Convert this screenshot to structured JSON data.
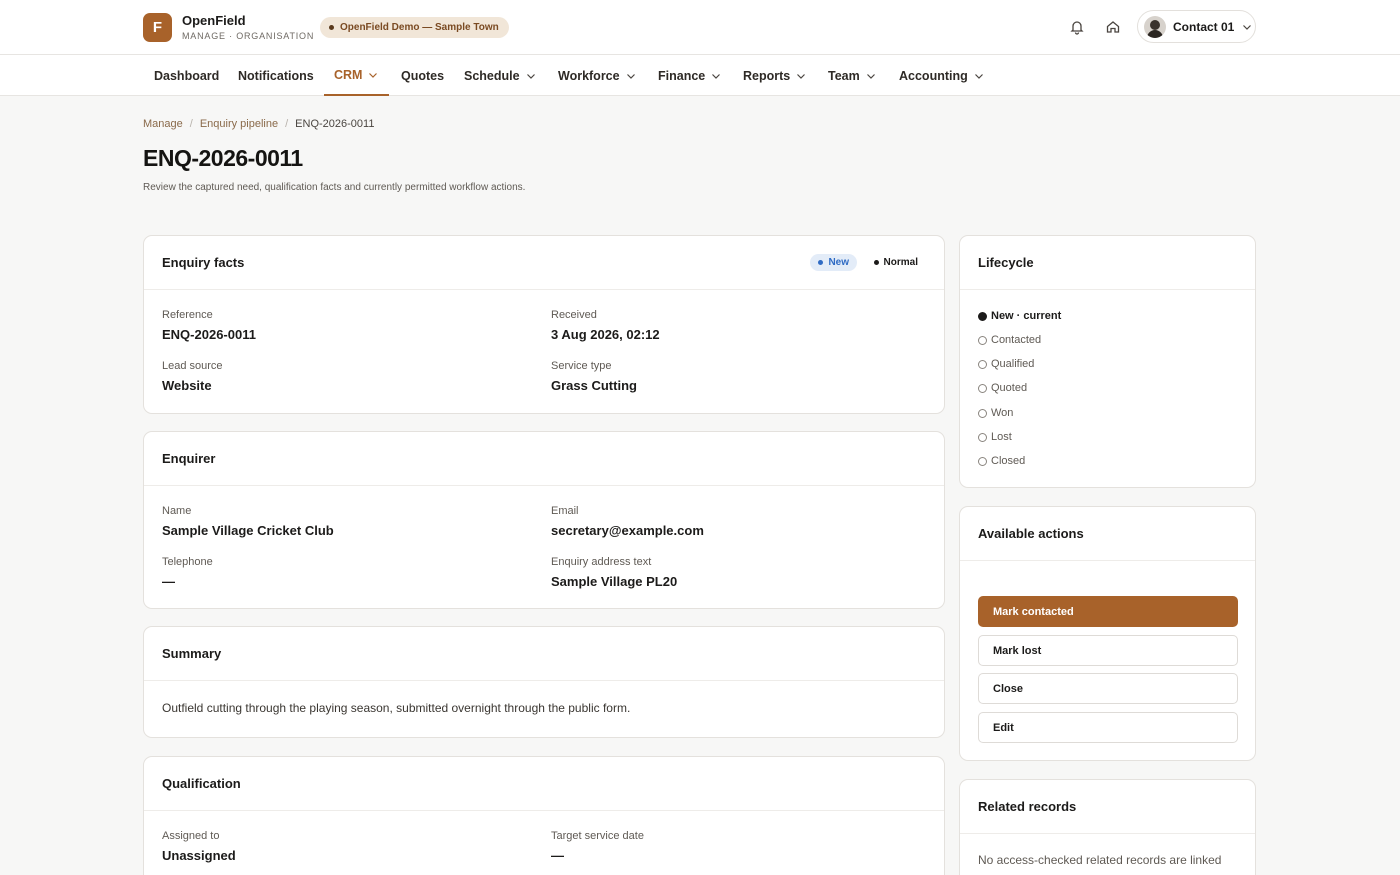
{
  "header": {
    "logo_letter": "F",
    "brand_name": "OpenField",
    "brand_sub": "MANAGE · ORGANISATION",
    "org_label": "OpenField Demo — Sample Town",
    "user_name": "Contact 01",
    "icons": [
      "bell-icon",
      "home-icon"
    ]
  },
  "nav": {
    "items": [
      {
        "label": "Dashboard"
      },
      {
        "label": "Notifications"
      },
      {
        "label": "CRM"
      },
      {
        "label": "Quotes"
      },
      {
        "label": "Schedule"
      },
      {
        "label": "Workforce"
      },
      {
        "label": "Finance"
      },
      {
        "label": "Reports"
      },
      {
        "label": "Team"
      },
      {
        "label": "Accounting"
      }
    ],
    "active": "CRM"
  },
  "breadcrumb": {
    "items": [
      "Manage",
      "Enquiry pipeline"
    ],
    "current": "ENQ-2026-0011"
  },
  "page": {
    "title": "ENQ-2026-0011",
    "description": "Review the captured need, qualification facts and currently permitted workflow actions."
  },
  "facts": {
    "title": "Enquiry facts",
    "status_badge": "New",
    "priority_badge": "Normal",
    "reference_label": "Reference",
    "reference_value": "ENQ-2026-0011",
    "received_label": "Received",
    "received_value": "3 Aug 2026, 02:12",
    "lead_source_label": "Lead source",
    "lead_source_value": "Website",
    "service_type_label": "Service type",
    "service_type_value": "Grass Cutting"
  },
  "enquirer": {
    "title": "Enquirer",
    "name_label": "Name",
    "name_value": "Sample Village Cricket Club",
    "email_label": "Email",
    "email_value": "secretary@example.com",
    "telephone_label": "Telephone",
    "telephone_value": "—",
    "address_label": "Enquiry address text",
    "address_value": "Sample Village PL20"
  },
  "summary": {
    "title": "Summary",
    "text": "Outfield cutting through the playing season, submitted overnight through the public form."
  },
  "qualification": {
    "title": "Qualification",
    "assigned_label": "Assigned to",
    "assigned_value": "Unassigned",
    "target_label": "Target service date",
    "target_value": "—"
  },
  "lifecycle": {
    "title": "Lifecycle",
    "stages": [
      "New · current",
      "Contacted",
      "Qualified",
      "Quoted",
      "Won",
      "Lost",
      "Closed"
    ],
    "current_index": 0
  },
  "actions": {
    "title": "Available actions",
    "buttons": [
      "Mark contacted",
      "Mark lost",
      "Close",
      "Edit"
    ]
  },
  "related": {
    "title": "Related records",
    "text": "No access-checked related records are linked"
  },
  "colors": {
    "accent": "#a8622a",
    "new_badge": "#2f6bc4"
  }
}
